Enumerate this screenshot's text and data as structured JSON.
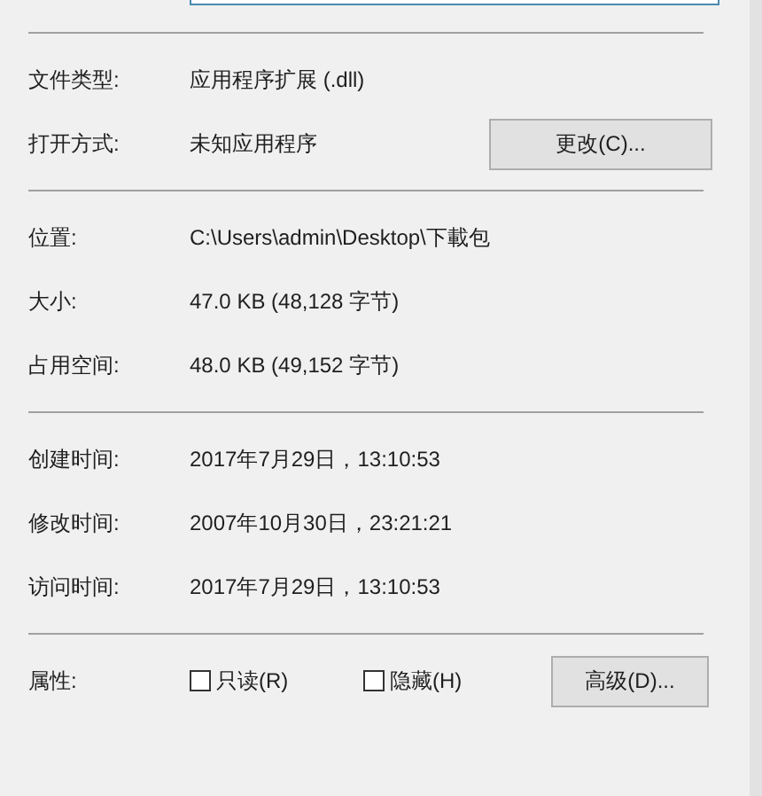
{
  "sections": [
    {
      "rows": [
        {
          "kind": "text",
          "label": "文件类型:",
          "value": "应用程序扩展 (.dll)"
        },
        {
          "kind": "text",
          "label": "打开方式:",
          "value": "未知应用程序",
          "button": "更改(C)..."
        }
      ]
    },
    {
      "rows": [
        {
          "kind": "text",
          "label": "位置:",
          "value": "C:\\Users\\admin\\Desktop\\下載包"
        },
        {
          "kind": "text",
          "label": "大小:",
          "value": "47.0 KB (48,128 字节)"
        },
        {
          "kind": "text",
          "label": "占用空间:",
          "value": "48.0 KB (49,152 字节)"
        }
      ]
    },
    {
      "rows": [
        {
          "kind": "text",
          "label": "创建时间:",
          "value": "2017年7月29日，13:10:53"
        },
        {
          "kind": "text",
          "label": "修改时间:",
          "value": "2007年10月30日，23:21:21"
        },
        {
          "kind": "text",
          "label": "访问时间:",
          "value": "2017年7月29日，13:10:53"
        }
      ]
    },
    {
      "rows": [
        {
          "kind": "attributes",
          "label": "属性:",
          "checkboxes": [
            {
              "label": "只读(R)",
              "checked": false
            },
            {
              "label": "隐藏(H)",
              "checked": false
            }
          ],
          "button": "高级(D)..."
        }
      ]
    }
  ]
}
